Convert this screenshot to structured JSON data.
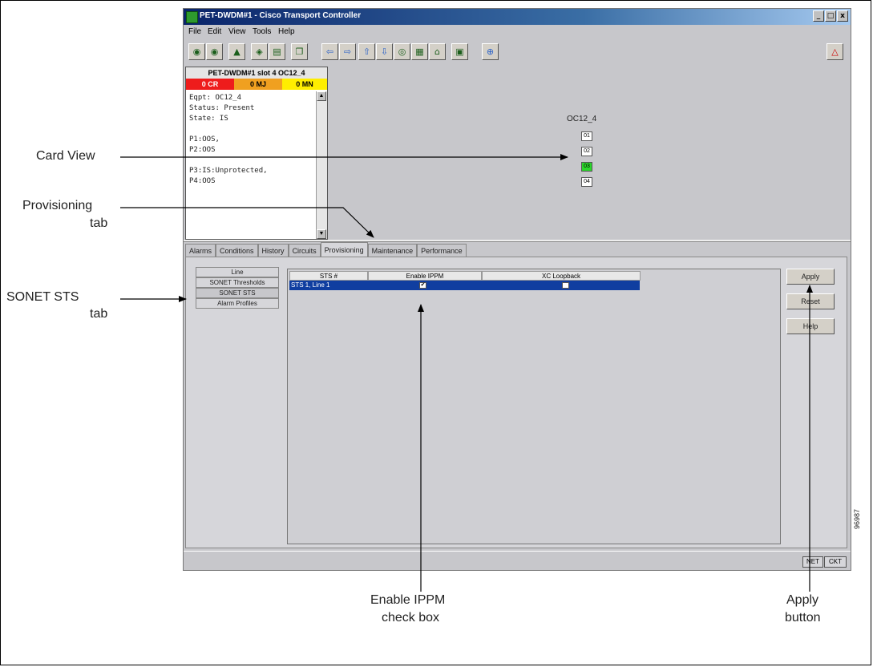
{
  "window": {
    "title": "PET-DWDM#1 - Cisco Transport Controller",
    "controls": [
      "_",
      "□",
      "x"
    ]
  },
  "menu": [
    "File",
    "Edit",
    "View",
    "Tools",
    "Help"
  ],
  "toolbar_icons": [
    "open-node-icon",
    "close-node-icon",
    "lock-icon",
    "print-icon",
    "export-icon",
    "copy-icon",
    "back-icon",
    "forward-icon",
    "up-icon",
    "down-icon",
    "network-view-icon",
    "node-view-icon",
    "home-icon",
    "card-view-icon",
    "zoom-icon",
    "alarm-filter-icon"
  ],
  "alarm_panel": {
    "header": "PET-DWDM#1 slot 4 OC12_4",
    "cr": "0 CR",
    "mj": "0 MJ",
    "mn": "0 MN",
    "info_lines": [
      "Eqpt: OC12_4",
      "Status: Present",
      "State: IS",
      "",
      "P1:OOS,",
      "P2:OOS",
      "",
      "P3:IS:Unprotected,",
      "P4:OOS"
    ]
  },
  "card": {
    "label": "OC12_4",
    "ports": [
      "01",
      "02",
      "03",
      "04"
    ],
    "active_port": "03"
  },
  "tabs": [
    "Alarms",
    "Conditions",
    "History",
    "Circuits",
    "Provisioning",
    "Maintenance",
    "Performance"
  ],
  "active_tab": "Provisioning",
  "subtabs": [
    "Line",
    "SONET Thresholds",
    "SONET STS",
    "Alarm Profiles"
  ],
  "table": {
    "headers": [
      "STS #",
      "Enable IPPM",
      "XC Loopback"
    ],
    "rows": [
      {
        "sts": "STS 1, Line 1",
        "enable_ippm": true,
        "xc_loopback": false
      }
    ]
  },
  "buttons": {
    "apply": "Apply",
    "reset": "Reset",
    "help": "Help"
  },
  "status": {
    "net": "NET",
    "ckt": "CKT"
  },
  "annotations": {
    "card_view": "Card View",
    "provisioning_tab_1": "Provisioning",
    "provisioning_tab_2": "tab",
    "sonet_sts_1": "SONET STS",
    "sonet_sts_2": "tab",
    "enable_ippm_1": "Enable IPPM",
    "enable_ippm_2": "check box",
    "apply_1": "Apply",
    "apply_2": "button"
  },
  "figure_number": "96987"
}
